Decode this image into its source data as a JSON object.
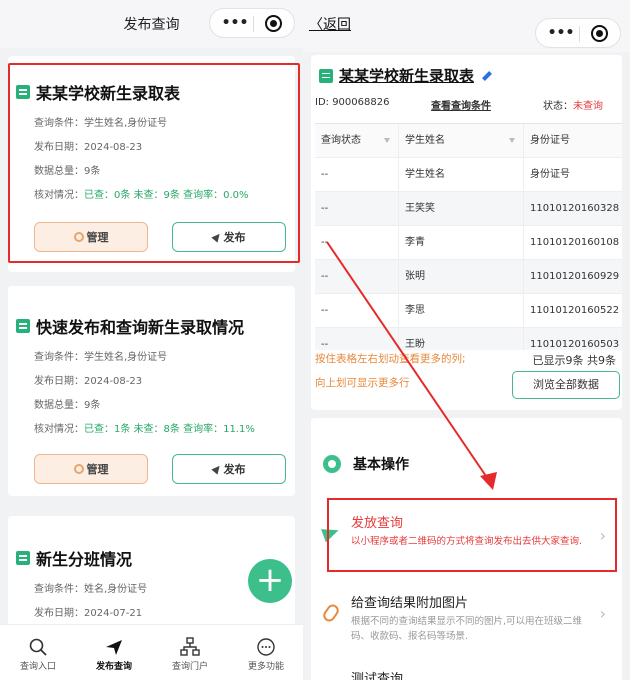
{
  "left": {
    "nav_title": "发布查询",
    "capsule_dots": "•••",
    "cards": [
      {
        "title": "某某学校新生录取表",
        "condition": "查询条件：学生姓名,身份证号",
        "date": "发布日期：2024-08-23",
        "total": "数据总量：9条",
        "check_prefix": "核对情况：",
        "check_stats": "已查：0条 未查：9条 查询率：0.0%",
        "manage": "管理",
        "publish": "发布"
      },
      {
        "title": "快速发布和查询新生录取情况",
        "condition": "查询条件：学生姓名,身份证号",
        "date": "发布日期：2024-08-23",
        "total": "数据总量：9条",
        "check_prefix": "核对情况：",
        "check_stats": "已查：1条 未查：8条 查询率：11.1%",
        "manage": "管理",
        "publish": "发布"
      },
      {
        "title": "新生分班情况",
        "condition": "查询条件：姓名,身份证号",
        "date": "发布日期：2024-07-21"
      }
    ],
    "fab": "+",
    "tabs": [
      {
        "label": "查询入口",
        "icon": "search-icon"
      },
      {
        "label": "发布查询",
        "icon": "send-icon",
        "active": true
      },
      {
        "label": "查询门户",
        "icon": "sitemap-icon"
      },
      {
        "label": "更多功能",
        "icon": "more-icon"
      }
    ]
  },
  "right": {
    "back": "返回",
    "capsule_dots": "•••",
    "title": "某某学校新生录取表",
    "id_text": "ID: 900068826",
    "view_condition": "查看查询条件",
    "status_label": "状态：",
    "status_value": "未查询",
    "table": {
      "headers": [
        "查询状态",
        "学生姓名",
        "身份证号"
      ],
      "rows": [
        [
          "--",
          "学生姓名",
          "身份证号"
        ],
        [
          "--",
          "王笑笑",
          "11010120160328"
        ],
        [
          "--",
          "李青",
          "11010120160108"
        ],
        [
          "--",
          "张明",
          "11010120160929"
        ],
        [
          "--",
          "李思",
          "11010120160522"
        ],
        [
          "--",
          "王盼",
          "11010120160503"
        ]
      ]
    },
    "hint_line1": "按住表格左右划动查看更多的列;",
    "hint_line2": "向上划可显示更多行",
    "shown_count": "已显示9条 共9条",
    "browse_all": "浏览全部数据",
    "ops_title": "基本操作",
    "ops": [
      {
        "name": "发放查询",
        "desc": "以小程序或者二维码的方式将查询发布出去供大家查询.",
        "icon": "paper-plane-icon"
      },
      {
        "name": "给查询结果附加图片",
        "desc": "根据不同的查询结果显示不同的图片,可以用在班级二维码、收款码、报名码等场景.",
        "icon": "paperclip-icon"
      },
      {
        "name": "测试查询",
        "desc": ""
      }
    ],
    "chevron": "›"
  },
  "colors": {
    "accent_green": "#3dbf8c",
    "highlight_red": "#e42a2a",
    "warn_orange": "#e8893a",
    "status_red": "#e53b3b"
  }
}
